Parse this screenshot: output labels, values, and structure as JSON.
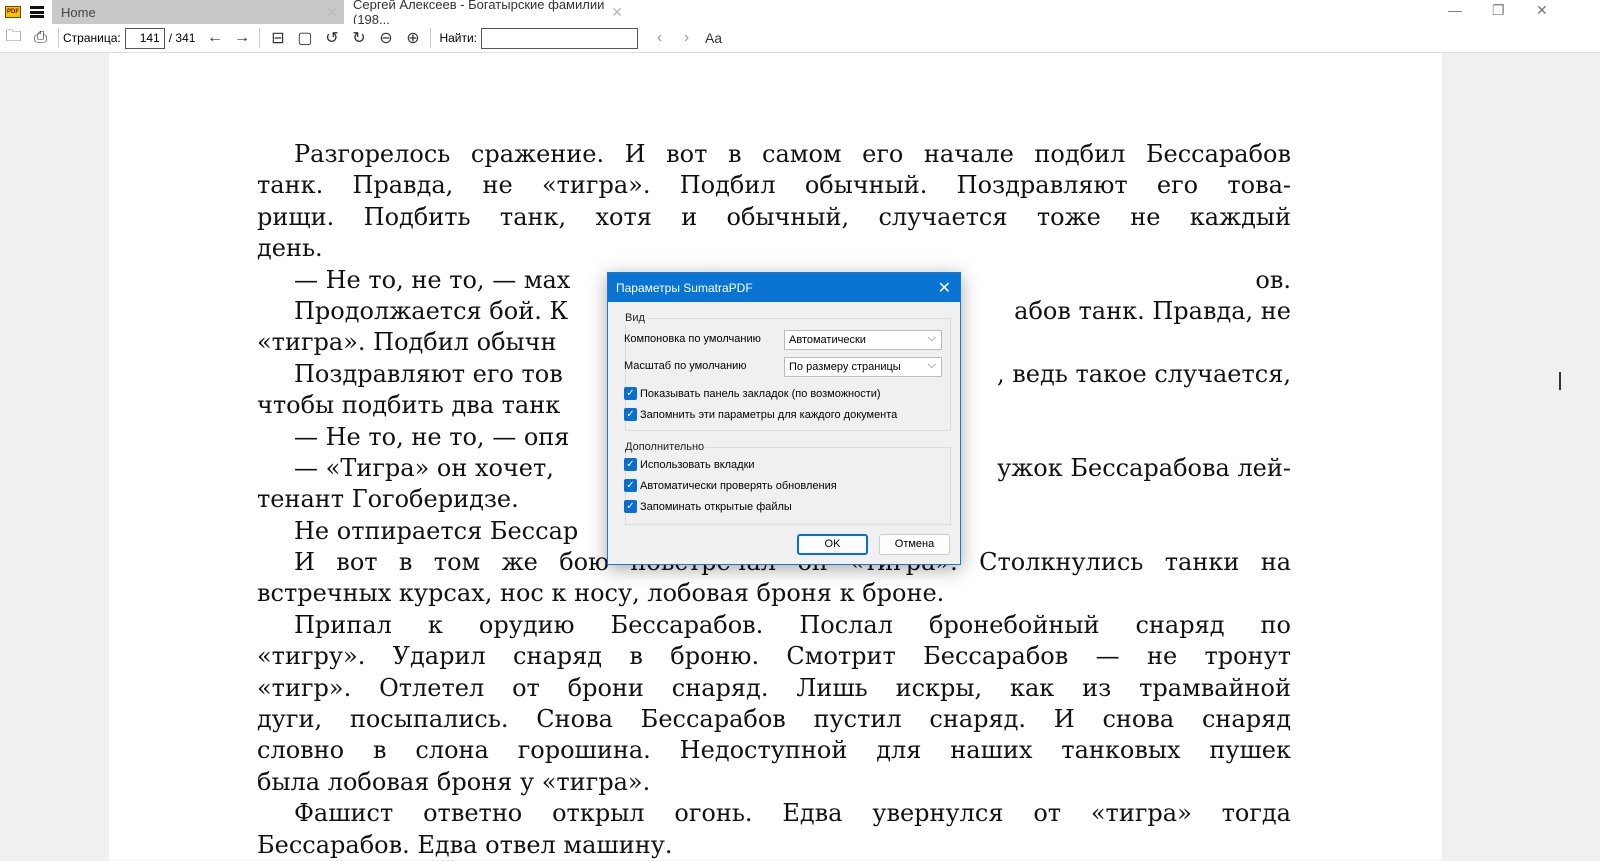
{
  "titlebar": {
    "logo": "PDF",
    "tabs": [
      {
        "label": "Home"
      },
      {
        "label": "Сергей Алексеев - Богатырские фамилии (198..."
      }
    ],
    "close_glyph": "✕",
    "minimize": "—",
    "restore": "❐",
    "close": "✕"
  },
  "toolbar": {
    "page_label": "Страница:",
    "page_value": "141",
    "page_total": "/ 341",
    "find_label": "Найти:",
    "find_value": "",
    "font_icon": "Aa"
  },
  "document": {
    "lines": [
      {
        "t": "Разгорелось сражение. И вот в самом его начале подбил Бессарабов"
      },
      {
        "t": "танк. Правда, не «тигра». Подбил обычный. Поздравляют его това-"
      },
      {
        "t": "рищи. Подбить танк, хотя и обычный, случается тоже не каждый"
      },
      {
        "t": "день."
      },
      {
        "l": "— Не то, не то, — мах",
        "r": "ов."
      },
      {
        "l": "Продолжается бой. К",
        "r": "абов танк. Правда, не"
      },
      {
        "l": "«тигра». Подбил обычн",
        "r": ""
      },
      {
        "l": "Поздравляют его тов",
        "r": ", ведь такое случается,"
      },
      {
        "l": "чтобы подбить два танк",
        "r": ""
      },
      {
        "l": "— Не то, не то, — опя",
        "r": ""
      },
      {
        "l": "— «Тигра» он хочет,",
        "r": "ужок Бессарабова лей-"
      },
      {
        "t": "тенант Гогоберидзе."
      },
      {
        "l": "Не отпирается Бессар",
        "r": ""
      },
      {
        "t": "И вот в том же бою повстречал он «тигра». Столкнулись танки на"
      },
      {
        "t": "встречных курсах, нос к носу, лобовая броня к броне."
      },
      {
        "t": "Припал к орудию Бессарабов. Послал бронебойный снаряд по"
      },
      {
        "t": "«тигру». Ударил снаряд в броню. Смотрит Бессарабов — не тронут"
      },
      {
        "t": "«тигр». Отлетел от брони снаряд. Лишь искры, как из трамвайной"
      },
      {
        "t": "дуги, посыпались. Снова Бессарабов пустил снаряд. И снова снаряд"
      },
      {
        "t": "словно в слона горошина. Недоступной для наших танковых пушек"
      },
      {
        "t": "была лобовая броня у «тигра»."
      },
      {
        "t": "Фашист ответно открыл огонь. Едва увернулся от «тигра» тогда"
      },
      {
        "t": "Бессарабов. Едва отвел машину."
      }
    ]
  },
  "dialog": {
    "title": "Параметры SumatraPDF",
    "close": "✕",
    "view_group": "Вид",
    "layout_label": "Компоновка по умолчанию",
    "layout_value": "Автоматически",
    "zoom_label": "Масштаб по умолчанию",
    "zoom_value": "По размеру страницы",
    "cb_bookmarks": "Показывать панель закладок (по возможности)",
    "cb_remember": "Запомнить эти параметры для каждого документа",
    "adv_group": "Дополнительно",
    "cb_tabs": "Использовать вкладки",
    "cb_updates": "Автоматически проверять обновления",
    "cb_files": "Запоминать открытые файлы",
    "check": "✓",
    "chev": "⌵",
    "ok": "OK",
    "cancel": "Отмена"
  }
}
